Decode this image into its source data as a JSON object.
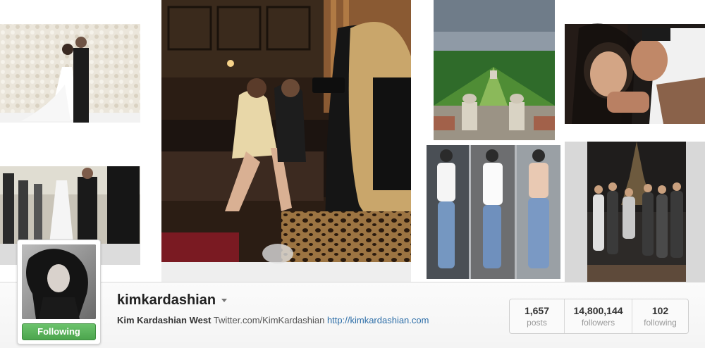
{
  "profile": {
    "username": "kimkardashian",
    "full_name": "Kim Kardashian West",
    "twitter": "Twitter.com/KimKardashian",
    "website": "http://kimkardashian.com",
    "follow_button_label": "Following",
    "follow_button_color": "#55ab56"
  },
  "stats": [
    {
      "value": "1,657",
      "label": "posts"
    },
    {
      "value": "14,800,144",
      "label": "followers"
    },
    {
      "value": "102",
      "label": "following"
    }
  ],
  "colors": {
    "link": "#2d6ea8",
    "username": "#222222",
    "stat_label": "#999999"
  }
}
